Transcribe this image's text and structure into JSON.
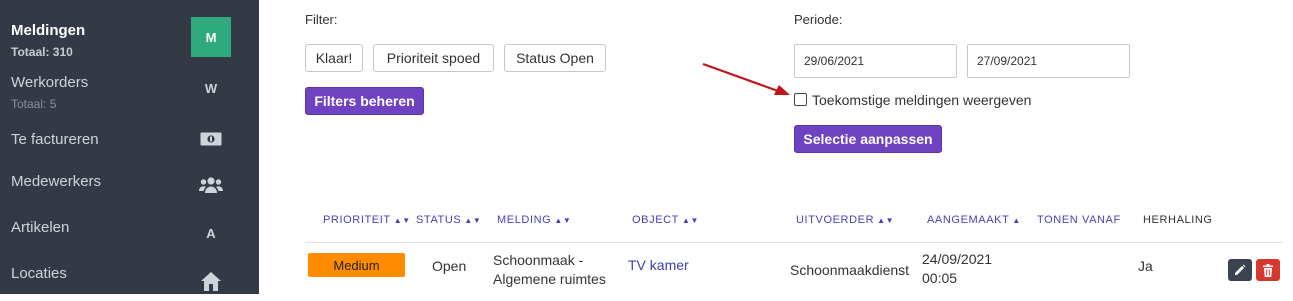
{
  "sidebar": {
    "items": [
      {
        "label": "Meldingen",
        "sub": "Totaal: 310",
        "icon": "M",
        "icon_name": "letter-m-icon",
        "active": true
      },
      {
        "label": "Werkorders",
        "sub": "Totaal: 5",
        "icon": "W",
        "icon_name": "letter-w-icon"
      },
      {
        "label": "Te factureren",
        "icon_name": "money-icon"
      },
      {
        "label": "Medewerkers",
        "icon_name": "users-icon"
      },
      {
        "label": "Artikelen",
        "icon": "A",
        "icon_name": "letter-a-icon"
      },
      {
        "label": "Locaties",
        "icon_name": "home-icon"
      }
    ]
  },
  "filter": {
    "label": "Filter:",
    "chips": [
      "Klaar!",
      "Prioriteit spoed",
      "Status Open"
    ],
    "manage_button": "Filters beheren"
  },
  "periode": {
    "label": "Periode:",
    "from": "29/06/2021",
    "to": "27/09/2021",
    "checkbox_label": "Toekomstige meldingen weergeven",
    "checkbox_checked": false,
    "apply_button": "Selectie aanpassen"
  },
  "table": {
    "headers": [
      "PRIORITEIT",
      "STATUS",
      "MELDING",
      "OBJECT",
      "UITVOERDER",
      "AANGEMAAKT",
      "TONEN VANAF",
      "HERHALING"
    ],
    "rows": [
      {
        "prioriteit": "Medium",
        "status": "Open",
        "melding_line1": "Schoonmaak -",
        "melding_line2": "Algemene ruimtes",
        "object": "TV kamer",
        "uitvoerder": "Schoonmaakdienst",
        "aangemaakt_line1": "24/09/2021",
        "aangemaakt_line2": "00:05",
        "tonen_vanaf": "",
        "herhaling": "Ja"
      }
    ]
  },
  "colors": {
    "sidebar_bg": "#343a45",
    "active_icon_bg": "#2eaa7c",
    "accent_purple": "#6f42c1",
    "priority_medium": "#ff8c00",
    "edit_button": "#3c4350",
    "delete_button": "#d63a2f",
    "arrow": "#c0151a"
  }
}
